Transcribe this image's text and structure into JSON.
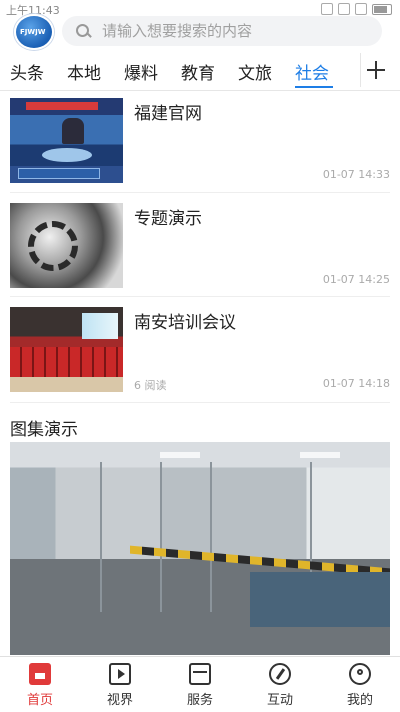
{
  "status_bar": {
    "time": "上午11:43"
  },
  "header": {
    "logo_text": "FJWJW",
    "search": {
      "placeholder": "请输入想要搜索的内容"
    }
  },
  "tabs": [
    {
      "label": "头条"
    },
    {
      "label": "本地"
    },
    {
      "label": "爆料"
    },
    {
      "label": "教育"
    },
    {
      "label": "文旅"
    },
    {
      "label": "社会"
    }
  ],
  "active_tab": "社会",
  "news": [
    {
      "title": "福建官网",
      "reads": "",
      "time": "01-07 14:33"
    },
    {
      "title": "专题演示",
      "reads": "",
      "time": "01-07 14:25"
    },
    {
      "title": "南安培训会议",
      "reads": "6 阅读",
      "time": "01-07 14:18"
    }
  ],
  "gallery": {
    "section_title": "图集演示"
  },
  "bottom_nav": [
    {
      "label": "首页",
      "icon": "home-icon"
    },
    {
      "label": "视界",
      "icon": "video-icon"
    },
    {
      "label": "服务",
      "icon": "service-icon"
    },
    {
      "label": "互动",
      "icon": "compass-icon"
    },
    {
      "label": "我的",
      "icon": "profile-icon"
    }
  ],
  "colors": {
    "accent": "#1e7ee6",
    "nav_active": "#e03a3a"
  }
}
